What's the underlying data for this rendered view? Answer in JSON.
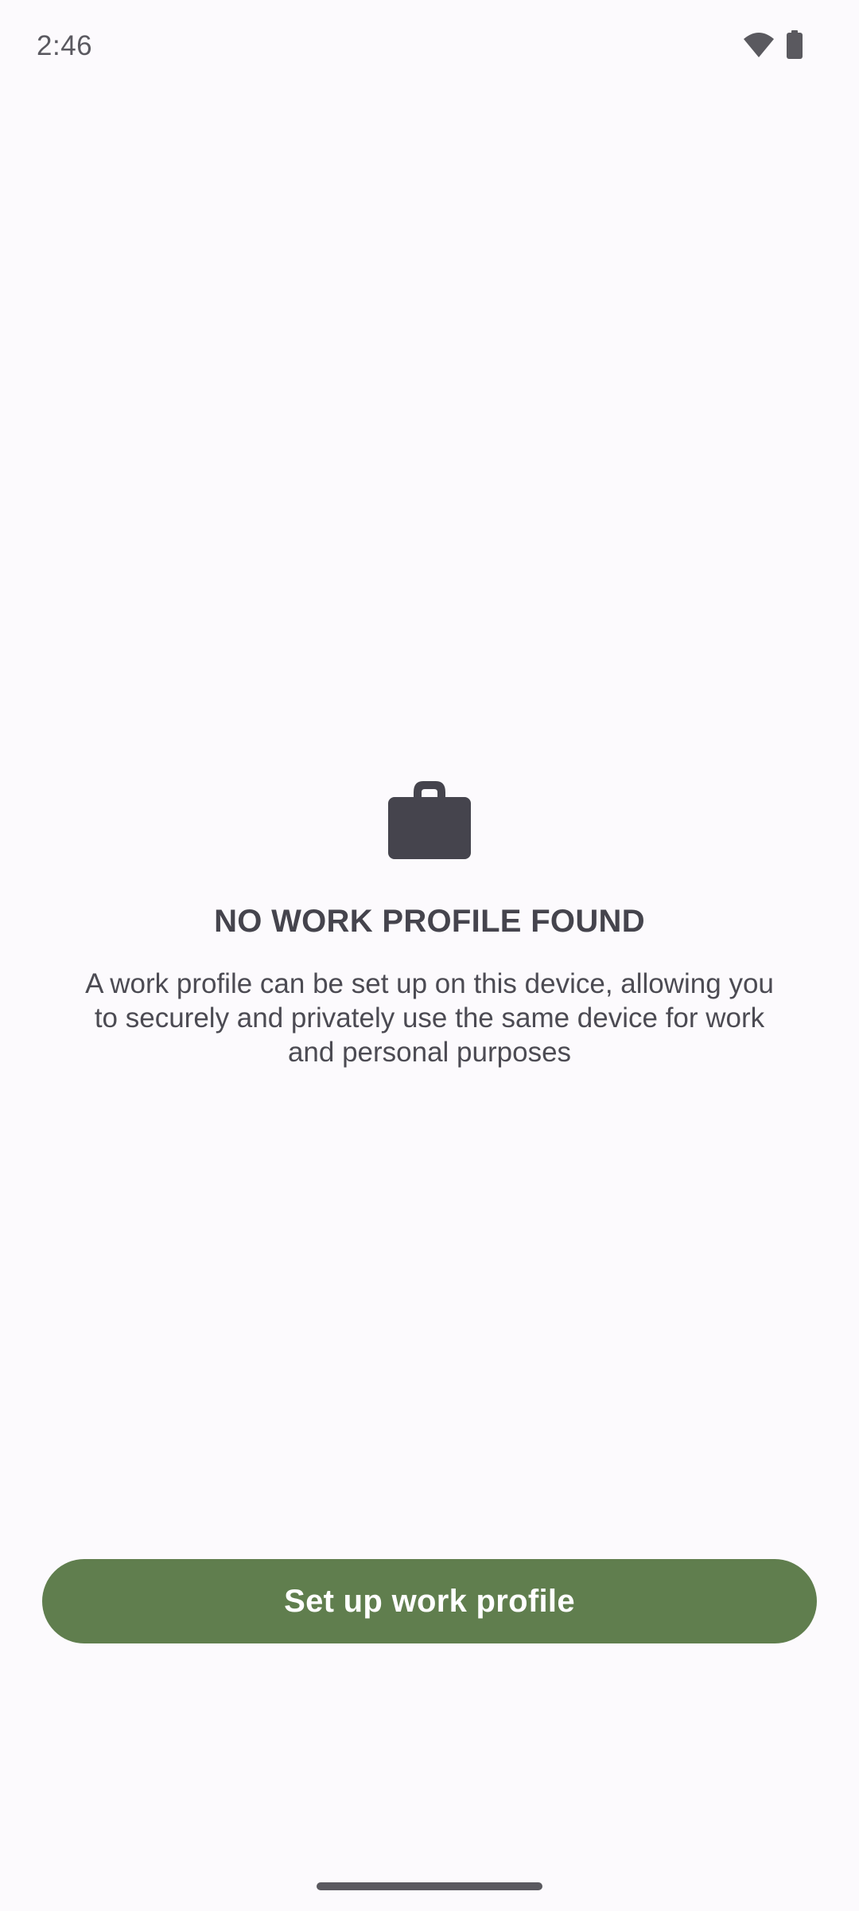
{
  "status_bar": {
    "time": "2:46",
    "icons": [
      "wifi-icon",
      "battery-icon"
    ]
  },
  "empty_state": {
    "icon": "briefcase-icon",
    "title": "NO WORK PROFILE FOUND",
    "description": "A work profile can be set up on this device, allowing you to securely and privately use the same device for work and personal purposes"
  },
  "actions": {
    "setup_label": "Set up work profile"
  },
  "colors": {
    "background": "#fcfafd",
    "accent": "#607e4e",
    "text": "#45444d"
  }
}
